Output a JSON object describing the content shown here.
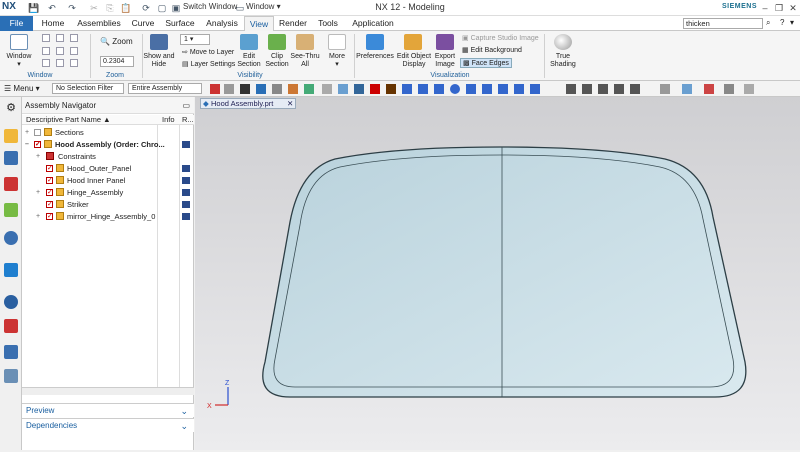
{
  "titlebar": {
    "app_logo": "NX",
    "switch_window": "Switch Window",
    "window_menu": "Window",
    "title": "NX 12 - Modeling",
    "brand": "SIEMENS",
    "minimize": "–",
    "restore": "❐",
    "close": "✕"
  },
  "tabs": {
    "file": "File",
    "home": "Home",
    "assemblies": "Assemblies",
    "curve": "Curve",
    "surface": "Surface",
    "analysis": "Analysis",
    "view": "View",
    "render": "Render",
    "tools": "Tools",
    "application": "Application",
    "search_value": "thicken"
  },
  "ribbon": {
    "window_btn": "Window",
    "zoom_btn": "Zoom",
    "zoom_value": "0.2304",
    "layer_value": "1",
    "show_hide": "Show and Hide",
    "move_to_layer": "Move to Layer",
    "layer_settings": "Layer Settings",
    "edit_section": "Edit Section",
    "clip_section": "Clip Section",
    "see_thru": "See-Thru All",
    "more": "More",
    "preferences": "Preferences",
    "edit_object_display": "Edit Object Display",
    "export_image": "Export Image",
    "capture_studio_image": "Capture Studio Image",
    "edit_background": "Edit Background",
    "face_edges": "Face Edges",
    "true_shading": "True Shading",
    "groups": {
      "window": "Window",
      "zoom": "Zoom",
      "visibility": "Visibility",
      "visualization": "Visualization"
    }
  },
  "toolbar2": {
    "menu": "Menu",
    "selection_filter": "No Selection Filter",
    "scope": "Entire Assembly"
  },
  "navigator": {
    "title": "Assembly Navigator",
    "columns": {
      "name": "Descriptive Part Name",
      "info": "Info",
      "r": "R..."
    },
    "rows": [
      {
        "label": "Sections",
        "indent": 0
      },
      {
        "label": "Hood Assembly (Order: Chro...",
        "indent": 0,
        "bold": true
      },
      {
        "label": "Constraints",
        "indent": 1
      },
      {
        "label": "Hood_Outer_Panel",
        "indent": 1
      },
      {
        "label": "Hood Inner Panel",
        "indent": 1
      },
      {
        "label": "Hinge_Assembly",
        "indent": 1
      },
      {
        "label": "Striker",
        "indent": 1
      },
      {
        "label": "mirror_Hinge_Assembly_0",
        "indent": 1
      }
    ],
    "preview": "Preview",
    "dependencies": "Dependencies"
  },
  "viewport": {
    "tab_label": "Hood Assembly.prt",
    "axis_x": "X",
    "axis_z": "Z"
  },
  "colors": {
    "accent": "#2a6fb6",
    "hood_fill": "#c9dde6",
    "hood_edge": "#2c3e45"
  }
}
